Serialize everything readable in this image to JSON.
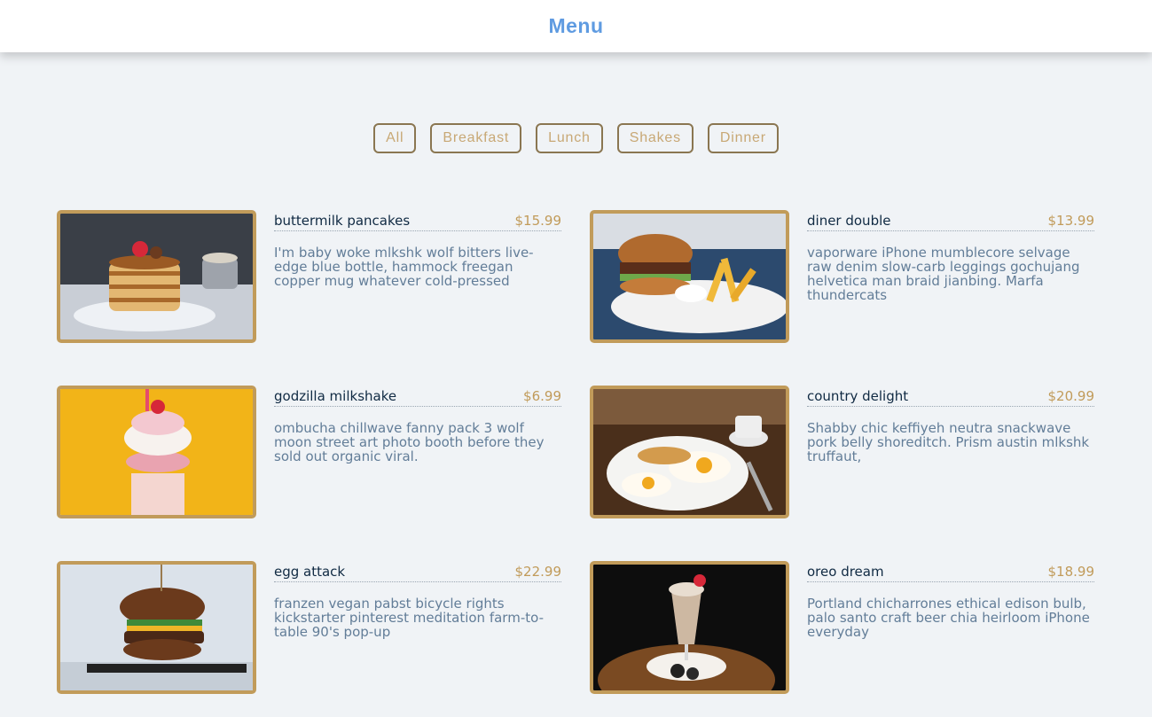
{
  "header": {
    "title": "Menu"
  },
  "filters": [
    "All",
    "Breakfast",
    "Lunch",
    "Shakes",
    "Dinner"
  ],
  "items": [
    {
      "name": "buttermilk pancakes",
      "price": "$15.99",
      "desc": "I'm baby woke mlkshk wolf bitters live-edge blue bottle, hammock freegan copper mug whatever cold-pressed",
      "photo_icon": "pancakes-photo"
    },
    {
      "name": "diner double",
      "price": "$13.99",
      "desc": "vaporware iPhone mumblecore selvage raw denim slow-carb leggings gochujang helvetica man braid jianbing. Marfa thundercats",
      "photo_icon": "burger-fries-photo"
    },
    {
      "name": "godzilla milkshake",
      "price": "$6.99",
      "desc": "ombucha chillwave fanny pack 3 wolf moon street art photo booth before they sold out organic viral.",
      "photo_icon": "milkshake-photo"
    },
    {
      "name": "country delight",
      "price": "$20.99",
      "desc": "Shabby chic keffiyeh neutra snackwave pork belly shoreditch. Prism austin mlkshk truffaut,",
      "photo_icon": "eggs-breakfast-photo"
    },
    {
      "name": "egg attack",
      "price": "$22.99",
      "desc": "franzen vegan pabst bicycle rights kickstarter pinterest meditation farm-to-table 90's pop-up",
      "photo_icon": "burger-photo"
    },
    {
      "name": "oreo dream",
      "price": "$18.99",
      "desc": "Portland chicharrones ethical edison bulb, palo santo craft beer chia heirloom iPhone everyday",
      "photo_icon": "oreo-shake-photo"
    }
  ],
  "colors": {
    "accent": "#c19b5a",
    "title": "#5f9be1",
    "background": "#f0f3f6",
    "text": "#627d98"
  }
}
